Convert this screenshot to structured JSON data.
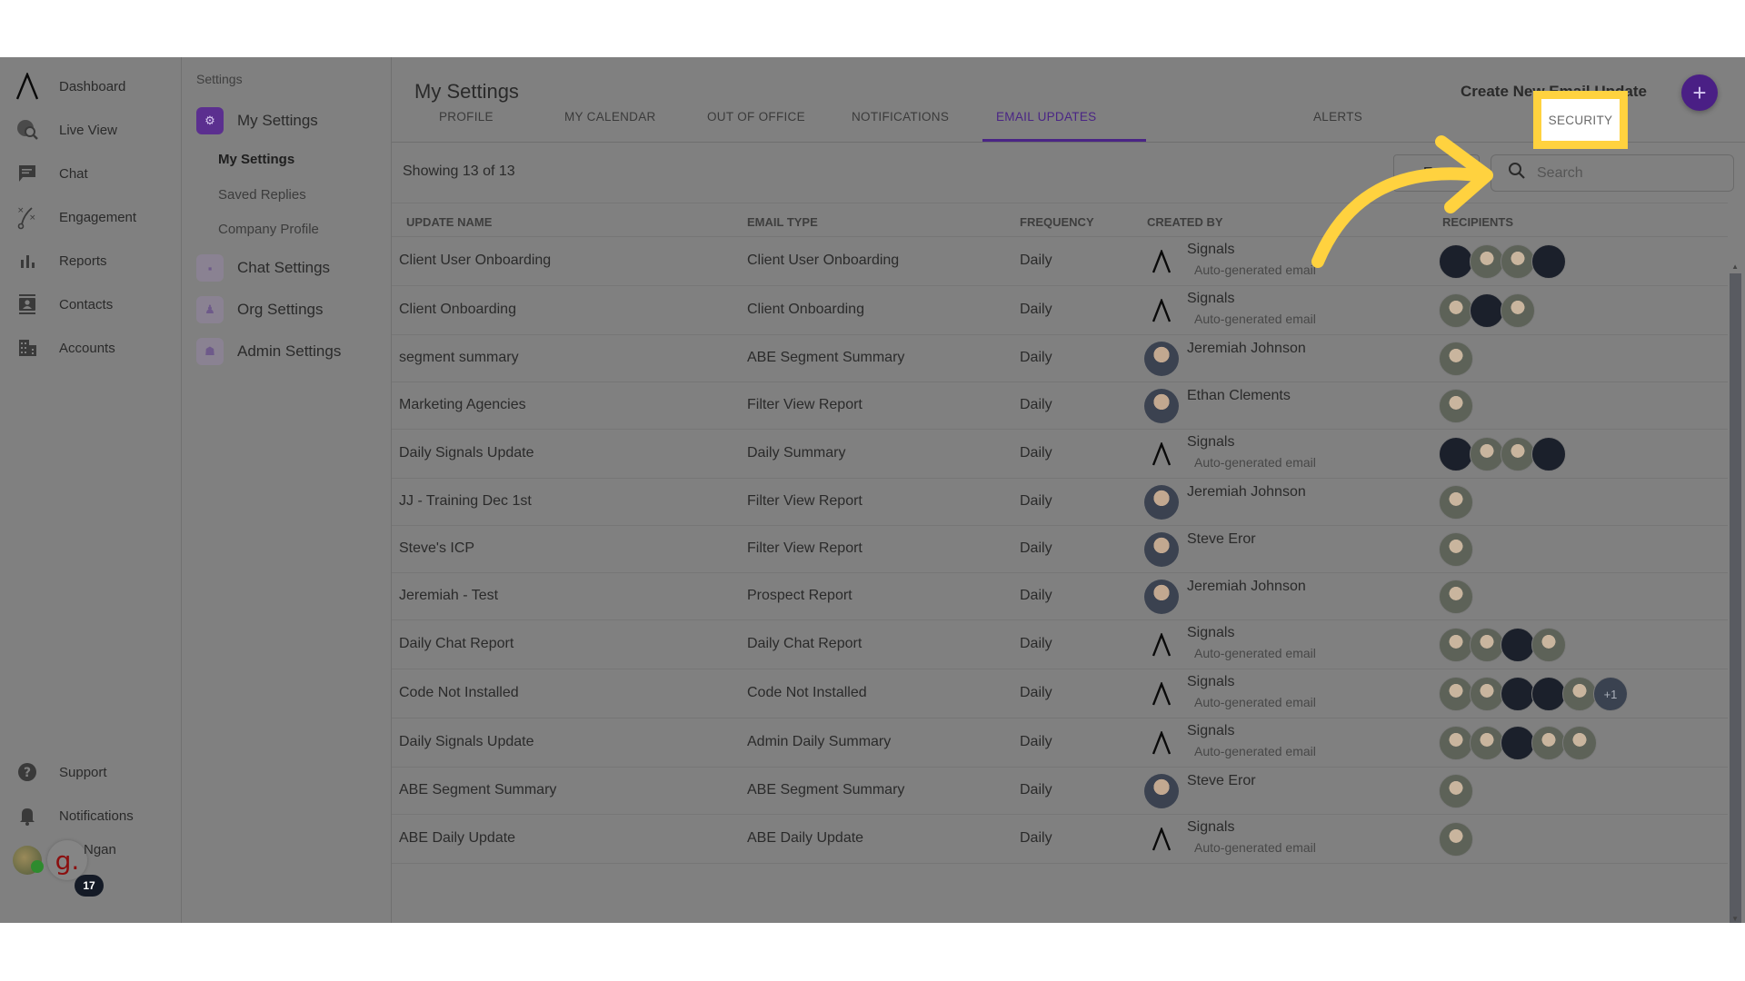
{
  "nav": {
    "items": [
      {
        "label": "Dashboard",
        "icon": "logo-icon"
      },
      {
        "label": "Live View",
        "icon": "live-view-icon"
      },
      {
        "label": "Chat",
        "icon": "chat-icon"
      },
      {
        "label": "Engagement",
        "icon": "engagement-icon"
      },
      {
        "label": "Reports",
        "icon": "reports-icon"
      },
      {
        "label": "Contacts",
        "icon": "contacts-icon"
      },
      {
        "label": "Accounts",
        "icon": "accounts-icon"
      }
    ],
    "bottom": [
      {
        "label": "Support",
        "icon": "help-icon"
      },
      {
        "label": "Notifications",
        "icon": "bell-icon"
      }
    ],
    "user": {
      "name": "Ngan",
      "badge_letter": "g.",
      "notification_count": "17"
    },
    "collapse_glyph": "‹"
  },
  "settings_sidebar": {
    "title": "Settings",
    "groups": [
      {
        "label": "My Settings",
        "active": true,
        "sub": [
          {
            "label": "My Settings",
            "active": true
          },
          {
            "label": "Saved Replies",
            "active": false
          },
          {
            "label": "Company Profile",
            "active": false
          }
        ]
      },
      {
        "label": "Chat Settings",
        "active": false
      },
      {
        "label": "Org Settings",
        "active": false
      },
      {
        "label": "Admin Settings",
        "active": false
      }
    ]
  },
  "main": {
    "title": "My Settings",
    "tabs": [
      {
        "label": "PROFILE"
      },
      {
        "label": "MY CALENDAR"
      },
      {
        "label": "OUT OF OFFICE"
      },
      {
        "label": "NOTIFICATIONS"
      },
      {
        "label": "EMAIL UPDATES",
        "active": true
      },
      {
        "label": "SECURITY",
        "highlighted": true
      },
      {
        "label": "ALERTS"
      }
    ],
    "create_label": "Create New Email Update",
    "create_glyph": "+",
    "showing": "Showing 13 of 13",
    "export_label": "Export",
    "search_placeholder": "Search",
    "columns": [
      "UPDATE NAME",
      "EMAIL TYPE",
      "FREQUENCY",
      "CREATED BY",
      "RECIPIENTS"
    ],
    "rows": [
      {
        "name": "Client User Onboarding",
        "type": "Client User Onboarding",
        "frequency": "Daily",
        "creator": "Signals",
        "creator_sub": "Auto-generated email",
        "recipients": [
          "dark",
          "photo",
          "photo",
          "dark"
        ]
      },
      {
        "name": "Client Onboarding",
        "type": "Client Onboarding",
        "frequency": "Daily",
        "creator": "Signals",
        "creator_sub": "Auto-generated email",
        "recipients": [
          "photo",
          "dark",
          "photo"
        ]
      },
      {
        "name": "segment summary",
        "type": "ABE Segment Summary",
        "frequency": "Daily",
        "creator": "Jeremiah Johnson",
        "creator_sub": "",
        "recipients": [
          "photo"
        ]
      },
      {
        "name": "Marketing Agencies",
        "type": "Filter View Report",
        "frequency": "Daily",
        "creator": "Ethan Clements",
        "creator_sub": "",
        "recipients": [
          "photo"
        ]
      },
      {
        "name": "Daily Signals Update",
        "type": "Daily Summary",
        "frequency": "Daily",
        "creator": "Signals",
        "creator_sub": "Auto-generated email",
        "recipients": [
          "dark",
          "photo",
          "photo",
          "dark"
        ]
      },
      {
        "name": "JJ - Training Dec 1st",
        "type": "Filter View Report",
        "frequency": "Daily",
        "creator": "Jeremiah Johnson",
        "creator_sub": "",
        "recipients": [
          "photo"
        ]
      },
      {
        "name": "Steve's ICP",
        "type": "Filter View Report",
        "frequency": "Daily",
        "creator": "Steve Eror",
        "creator_sub": "",
        "recipients": [
          "photo"
        ]
      },
      {
        "name": "Jeremiah - Test",
        "type": "Prospect Report",
        "frequency": "Daily",
        "creator": "Jeremiah Johnson",
        "creator_sub": "",
        "recipients": [
          "photo"
        ]
      },
      {
        "name": "Daily Chat Report",
        "type": "Daily Chat Report",
        "frequency": "Daily",
        "creator": "Signals",
        "creator_sub": "Auto-generated email",
        "recipients": [
          "photo",
          "photo",
          "dark",
          "photo"
        ]
      },
      {
        "name": "Code Not Installed",
        "type": "Code Not Installed",
        "frequency": "Daily",
        "creator": "Signals",
        "creator_sub": "Auto-generated email",
        "recipients": [
          "photo",
          "photo",
          "dark",
          "dark",
          "photo"
        ],
        "more": "+1"
      },
      {
        "name": "Daily Signals Update",
        "type": "Admin Daily Summary",
        "frequency": "Daily",
        "creator": "Signals",
        "creator_sub": "Auto-generated email",
        "recipients": [
          "photo",
          "photo",
          "dark",
          "photo",
          "photo"
        ]
      },
      {
        "name": "ABE Segment Summary",
        "type": "ABE Segment Summary",
        "frequency": "Daily",
        "creator": "Steve Eror",
        "creator_sub": "",
        "recipients": [
          "photo"
        ]
      },
      {
        "name": "ABE Daily Update",
        "type": "ABE Daily Update",
        "frequency": "Daily",
        "creator": "Signals",
        "creator_sub": "Auto-generated email",
        "recipients": [
          "photo"
        ]
      }
    ]
  },
  "colors": {
    "overlay": "#808080",
    "accent": "#4a1f85",
    "highlight": "#ffd23f"
  }
}
